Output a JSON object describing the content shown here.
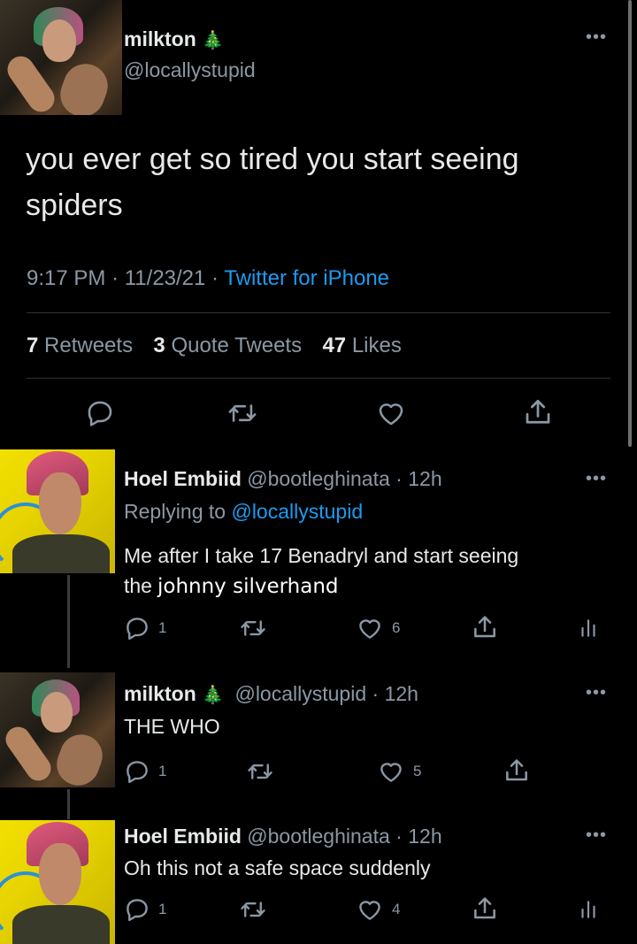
{
  "main_tweet": {
    "name": "milkton",
    "emoji": "🎄",
    "handle": "@locallystupid",
    "text_line1": "you ever get so tired you start seeing",
    "text_line2": "spiders",
    "time": "9:17 PM",
    "sep1": "·",
    "date": "11/23/21",
    "sep2": "·",
    "source": "Twitter for iPhone",
    "stats": {
      "retweets_count": "7",
      "retweets_label": "Retweets",
      "quotes_count": "3",
      "quotes_label": "Quote Tweets",
      "likes_count": "47",
      "likes_label": "Likes"
    },
    "actions": [
      "reply-icon",
      "retweet-icon",
      "heart-icon",
      "share-icon"
    ]
  },
  "replies": [
    {
      "name": "Hoel Embiid",
      "handle": "@bootleghinata",
      "sep": "·",
      "time": "12h",
      "replying_prefix": "Replying to",
      "replying_to": "@locallystupid",
      "text_line1": "Me after I take 17 Benadryl and start seeing",
      "text_line2a": "the",
      "text_line2b": "johnny silverhand",
      "reply_count": "1",
      "like_count": "6"
    },
    {
      "name": "milkton",
      "emoji": "🎄",
      "handle": "@locallystupid",
      "sep": "·",
      "time": "12h",
      "text_line1": "THE WHO",
      "reply_count": "1",
      "like_count": "5"
    },
    {
      "name": "Hoel Embiid",
      "handle": "@bootleghinata",
      "sep": "·",
      "time": "12h",
      "text_line1": "Oh this not a safe space suddenly",
      "reply_count": "1",
      "like_count": "4"
    }
  ],
  "more_glyph": "•••",
  "colors": {
    "background": "#000000",
    "text": "#e7e9ea",
    "muted": "#8b98a5",
    "link": "#1d9bf0",
    "divider": "#2f3336"
  }
}
